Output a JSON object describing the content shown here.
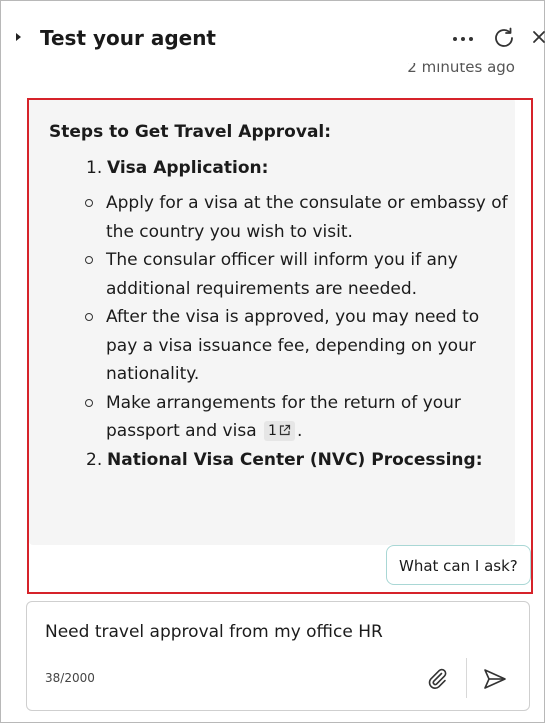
{
  "header": {
    "title": "Test your agent",
    "timestamp": "2 minutes ago"
  },
  "message": {
    "heading": "Steps to Get Travel Approval:",
    "steps": [
      {
        "number": "1.",
        "title": "Visa Application:",
        "items": [
          "Apply for a visa at the consulate or embassy of the country you wish to visit.",
          "The consular officer will inform you if any additional requirements are needed.",
          "After the visa is approved, you may need to pay a visa issuance fee, depending on your nationality.",
          "Make arrangements for the return of your passport and visa"
        ],
        "citation": "1",
        "trailing": "."
      },
      {
        "number": "2.",
        "title": "National Visa Center (NVC) Processing:"
      }
    ]
  },
  "suggestion": {
    "label": "What can I ask?"
  },
  "input": {
    "value": "Need travel approval from my office HR",
    "char_count": "38/2000"
  },
  "colors": {
    "highlight": "#d6232a",
    "chip_border": "#a9d7d5",
    "card_background": "#f5f5f5"
  },
  "icons": {
    "expand": "caret-right-icon",
    "more": "more-icon",
    "refresh": "refresh-icon",
    "close": "close-icon",
    "attach": "paperclip-icon",
    "send": "send-icon",
    "citation": "external-link-icon"
  }
}
